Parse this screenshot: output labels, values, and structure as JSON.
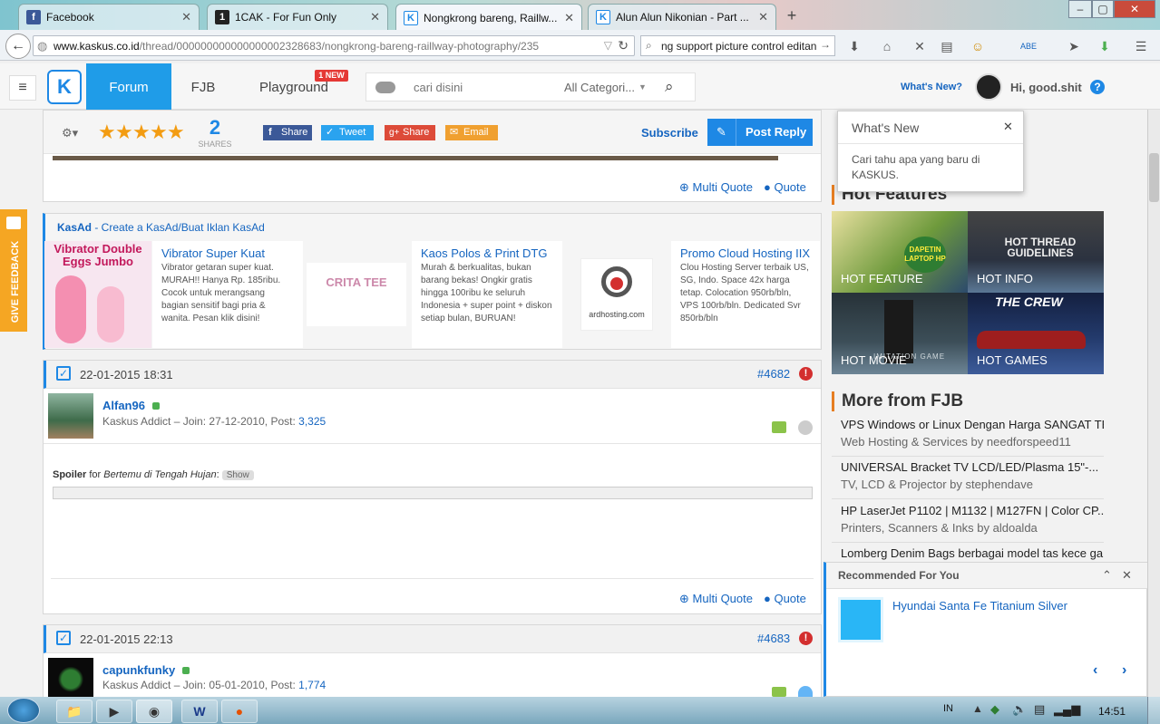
{
  "browser": {
    "tabs": [
      {
        "title": "Facebook",
        "favicon": "f",
        "color": "#3b5998"
      },
      {
        "title": "1CAK - For Fun Only",
        "favicon": "1",
        "color": "#222222"
      },
      {
        "title": "Nongkrong bareng, Raillw...",
        "favicon": "K",
        "color": "#1e88e5"
      },
      {
        "title": "Alun Alun Nikonian - Part ...",
        "favicon": "K",
        "color": "#1e88e5"
      }
    ],
    "url_domain": "www.kaskus.co.id",
    "url_path": "/thread/000000000000000002328683/nongkrong-bareng-raillway-photography/235",
    "search_value": "ng support picture control editan",
    "window_controls": [
      "–",
      "▢",
      "✕"
    ]
  },
  "header": {
    "nav_forum": "Forum",
    "nav_fjb": "FJB",
    "nav_playground": "Playground",
    "new_badge": "1 NEW",
    "search_placeholder": "cari disini",
    "category": "All Categori...",
    "whats_new": "What's New?",
    "greeting": "Hi, good.shit",
    "help": "?"
  },
  "thread_bar": {
    "shares_count": "2",
    "shares_label": "SHARES",
    "share_fb": "Share",
    "share_tw": "Tweet",
    "share_gp": "Share",
    "share_email": "Email",
    "subscribe": "Subscribe",
    "post_reply": "Post Reply",
    "rating_stars": 5
  },
  "post_actions": {
    "multi_quote": "Multi Quote",
    "quote": "Quote"
  },
  "kasad": {
    "title": "KasAd",
    "link": " - Create a KasAd/Buat Iklan KasAd",
    "ads": [
      {
        "title": "Vibrator Super Kuat",
        "text": "Vibrator getaran super kuat. MURAH!! Hanya Rp. 185ribu. Cocok untuk merangsang bagian sensitif bagi pria & wanita. Pesan klik disini!",
        "img_text": "Vibrator Double Eggs Jumbo"
      },
      {
        "title": "Kaos Polos & Print DTG",
        "text": "Murah & berkualitas, bukan barang bekas! Ongkir gratis hingga 100ribu ke seluruh Indonesia + super point + diskon setiap bulan, BURUAN!",
        "img_text": "CRITA TEE"
      },
      {
        "title": "Promo Cloud Hosting IIX",
        "text": "Clou Hosting Server terbaik US, SG, Indo. Space 42x harga tetap. Colocation 950rb/bln, VPS 100rb/bln. Dedicated Svr 850rb/bln",
        "img_text": "ardhosting.com"
      }
    ]
  },
  "posts": [
    {
      "date": "22-01-2015 18:31",
      "number": "#4682",
      "user": "Alfan96",
      "rank": "Kaskus Addict – Join: 27-12-2010, Post: ",
      "post_count": "3,325",
      "spoiler_label": "Spoiler",
      "spoiler_for": " for ",
      "spoiler_title": "Bertemu di Tengah Hujan",
      "spoiler_show": "Show"
    },
    {
      "date": "22-01-2015 22:13",
      "number": "#4683",
      "user": "capunkfunky",
      "rank": "Kaskus Addict – Join: 05-01-2010, Post: ",
      "post_count": "1,774"
    }
  ],
  "whats_new_popup": {
    "title": "What's New",
    "text": "Cari tahu apa yang baru di KASKUS."
  },
  "sidebar": {
    "hot_features_title": "Hot Features",
    "tiles": [
      {
        "label": "HOT FEATURE",
        "sub": "DAPETIN LAPTOP HP",
        "bg": "#5a7f3a"
      },
      {
        "label": "HOT INFO",
        "sub": "HOT THREAD GUIDELINES",
        "bg": "#3c3c44"
      },
      {
        "label": "HOT MOVIE",
        "sub": "IMITATION GAME",
        "bg": "#2e3a40"
      },
      {
        "label": "HOT GAMES",
        "sub": "THE CREW",
        "bg": "#1d2a4a"
      }
    ],
    "fjb_title": "More from FJB",
    "fjb_items": [
      {
        "title": "VPS Windows or Linux Dengan Harga SANGAT TERJ...",
        "sub": "Web Hosting & Services by needforspeed11"
      },
      {
        "title": "UNIVERSAL Bracket TV LCD/LED/Plasma 15\"-...",
        "sub": "TV, LCD & Projector by stephendave"
      },
      {
        "title": "HP LaserJet P1102 | M1132 | M127FN | Color CP...",
        "sub": "Printers, Scanners & Inks by aldoalda"
      },
      {
        "title": "Lomberg Denim Bags berbagai model tas kece ga...",
        "sub": ""
      }
    ],
    "recommended_title": "Recommended For You",
    "recommended_item": "Hyundai Santa Fe Titanium Silver"
  },
  "feedback": "GIVE FEEDBACK",
  "taskbar": {
    "lang": "IN",
    "time": "14:51"
  }
}
